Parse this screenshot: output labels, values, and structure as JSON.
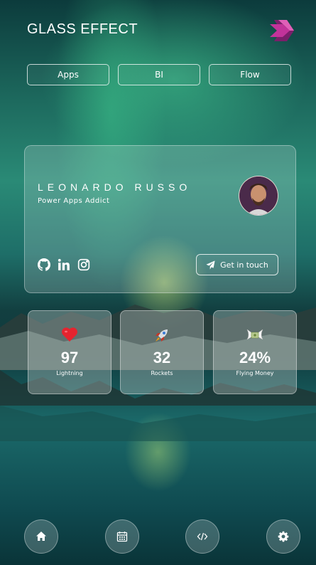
{
  "app": {
    "title": "GLASS EFFECT"
  },
  "tabs": [
    {
      "label": "Apps"
    },
    {
      "label": "BI"
    },
    {
      "label": "Flow"
    }
  ],
  "profile": {
    "name": "LEONARDO RUSSO",
    "subtitle": "Power Apps Addict",
    "contact_label": "Get in touch",
    "social_icons": [
      "github-icon",
      "linkedin-icon",
      "instagram-icon"
    ]
  },
  "stats": [
    {
      "icon": "heart-icon",
      "value": "97",
      "label": "Lightning"
    },
    {
      "icon": "rocket-icon",
      "value": "32",
      "label": "Rockets"
    },
    {
      "icon": "flying-money-icon",
      "value": "24%",
      "label": "Flying Money"
    }
  ],
  "bottom_nav": [
    "home-icon",
    "calendar-icon",
    "code-icon",
    "settings-icon"
  ],
  "colors": {
    "accent": "#ffffff",
    "brand_logo": "#c2339a",
    "heart": "#e5242f"
  }
}
